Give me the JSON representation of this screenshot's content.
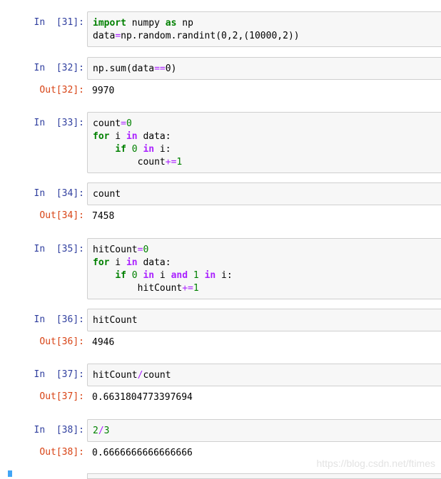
{
  "cells": [
    {
      "in_prompt": "In  [31]:",
      "lines": [
        [
          {
            "t": "import",
            "c": "kw"
          },
          {
            "t": " numpy "
          },
          {
            "t": "as",
            "c": "kw"
          },
          {
            "t": " np"
          }
        ],
        [
          {
            "t": "data"
          },
          {
            "t": "=",
            "c": "op"
          },
          {
            "t": "np.random.randint(0,2,(10000,2))"
          }
        ]
      ]
    },
    {
      "in_prompt": "In  [32]:",
      "lines": [
        [
          {
            "t": "np.sum(data"
          },
          {
            "t": "==",
            "c": "op"
          },
          {
            "t": "0"
          },
          {
            "t": ")"
          }
        ]
      ],
      "out_prompt": "Out[32]:",
      "output": "9970"
    },
    {
      "in_prompt": "In  [33]:",
      "lines": [
        [
          {
            "t": "count"
          },
          {
            "t": "=",
            "c": "op"
          },
          {
            "t": "0",
            "c": "num"
          }
        ],
        [
          {
            "t": "for",
            "c": "kw"
          },
          {
            "t": " i "
          },
          {
            "t": "in",
            "c": "ow"
          },
          {
            "t": " data:"
          }
        ],
        [
          {
            "t": "    "
          },
          {
            "t": "if",
            "c": "kw"
          },
          {
            "t": " "
          },
          {
            "t": "0",
            "c": "num"
          },
          {
            "t": " "
          },
          {
            "t": "in",
            "c": "ow"
          },
          {
            "t": " i:"
          }
        ],
        [
          {
            "t": "        count"
          },
          {
            "t": "+=",
            "c": "op"
          },
          {
            "t": "1",
            "c": "num"
          }
        ]
      ]
    },
    {
      "in_prompt": "In  [34]:",
      "lines": [
        [
          {
            "t": "count"
          }
        ]
      ],
      "out_prompt": "Out[34]:",
      "output": "7458"
    },
    {
      "in_prompt": "In  [35]:",
      "lines": [
        [
          {
            "t": "hitCount"
          },
          {
            "t": "=",
            "c": "op"
          },
          {
            "t": "0",
            "c": "num"
          }
        ],
        [
          {
            "t": "for",
            "c": "kw"
          },
          {
            "t": " i "
          },
          {
            "t": "in",
            "c": "ow"
          },
          {
            "t": " data:"
          }
        ],
        [
          {
            "t": "    "
          },
          {
            "t": "if",
            "c": "kw"
          },
          {
            "t": " "
          },
          {
            "t": "0",
            "c": "num"
          },
          {
            "t": " "
          },
          {
            "t": "in",
            "c": "ow"
          },
          {
            "t": " i "
          },
          {
            "t": "and",
            "c": "ow"
          },
          {
            "t": " "
          },
          {
            "t": "1",
            "c": "num"
          },
          {
            "t": " "
          },
          {
            "t": "in",
            "c": "ow"
          },
          {
            "t": " i:"
          }
        ],
        [
          {
            "t": "        hitCount"
          },
          {
            "t": "+=",
            "c": "op"
          },
          {
            "t": "1",
            "c": "num"
          }
        ]
      ]
    },
    {
      "in_prompt": "In  [36]:",
      "lines": [
        [
          {
            "t": "hitCount"
          }
        ]
      ],
      "out_prompt": "Out[36]:",
      "output": "4946"
    },
    {
      "in_prompt": "In  [37]:",
      "lines": [
        [
          {
            "t": "hitCount"
          },
          {
            "t": "/",
            "c": "op"
          },
          {
            "t": "count"
          }
        ]
      ],
      "out_prompt": "Out[37]:",
      "output": "0.6631804773397694"
    },
    {
      "in_prompt": "In  [38]:",
      "lines": [
        [
          {
            "t": "2",
            "c": "num"
          },
          {
            "t": "/",
            "c": "op"
          },
          {
            "t": "3",
            "c": "num"
          }
        ]
      ],
      "out_prompt": "Out[38]:",
      "output": "0.6666666666666666"
    }
  ],
  "watermark": "https://blog.csdn.net/ftimes",
  "colors": {
    "in_prompt": "#303f9f",
    "out_prompt": "#d84315",
    "keyword": "#008000",
    "operator": "#aa22ff",
    "cell_bg": "#f7f7f7",
    "active_bar": "#42a5f5"
  }
}
